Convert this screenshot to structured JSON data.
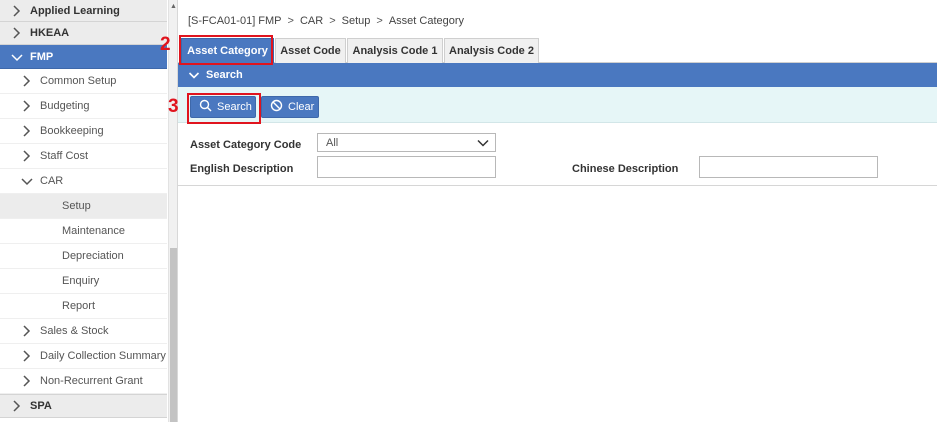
{
  "sidebar": {
    "items": [
      {
        "label": "Applied Learning",
        "type": "group"
      },
      {
        "label": "HKEAA",
        "type": "group"
      },
      {
        "label": "FMP",
        "type": "group-active"
      },
      {
        "label": "Common Setup",
        "type": "sub"
      },
      {
        "label": "Budgeting",
        "type": "sub"
      },
      {
        "label": "Bookkeeping",
        "type": "sub"
      },
      {
        "label": "Staff Cost",
        "type": "sub"
      },
      {
        "label": "CAR",
        "type": "sub-open"
      },
      {
        "label": "Setup",
        "type": "leaf-selected"
      },
      {
        "label": "Maintenance",
        "type": "leaf"
      },
      {
        "label": "Depreciation",
        "type": "leaf"
      },
      {
        "label": "Enquiry",
        "type": "leaf"
      },
      {
        "label": "Report",
        "type": "leaf"
      },
      {
        "label": "Sales & Stock",
        "type": "sub"
      },
      {
        "label": "Daily Collection Summary",
        "type": "sub"
      },
      {
        "label": "Non-Recurrent Grant",
        "type": "sub"
      },
      {
        "label": "SPA",
        "type": "group"
      }
    ]
  },
  "breadcrumb": {
    "items": [
      "[S-FCA01-01] FMP",
      "CAR",
      "Setup",
      "Asset Category"
    ],
    "separator": ">"
  },
  "tabs": [
    {
      "label": "Asset Category",
      "active": true
    },
    {
      "label": "Asset Code",
      "active": false
    },
    {
      "label": "Analysis Code 1",
      "active": false
    },
    {
      "label": "Analysis Code 2",
      "active": false
    }
  ],
  "markers": {
    "tab": "2",
    "search": "3"
  },
  "search_panel": {
    "title": "Search",
    "search_button": "Search",
    "clear_button": "Clear"
  },
  "form": {
    "asset_category_code": {
      "label": "Asset Category Code",
      "value": "All"
    },
    "english_description": {
      "label": "English Description",
      "value": ""
    },
    "chinese_description": {
      "label": "Chinese Description",
      "value": ""
    }
  },
  "colors": {
    "accent": "#4a78c0",
    "highlight": "#e0141e",
    "strip": "#e6f6f7"
  }
}
